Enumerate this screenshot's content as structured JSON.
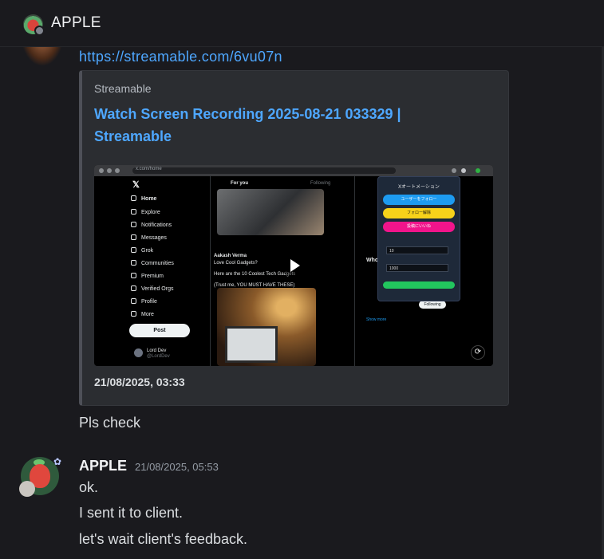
{
  "header": {
    "title": "APPLE"
  },
  "previous_message": {
    "link": "https://streamable.com/6vu07n",
    "embed": {
      "provider": "Streamable",
      "title": "Watch Screen Recording 2025-08-21 033329 | Streamable",
      "timestamp": "21/08/2025, 03:33",
      "video": {
        "browser_url": "x.com/home",
        "x_nav": [
          "Home",
          "Explore",
          "Notifications",
          "Messages",
          "Grok",
          "Communities",
          "Premium",
          "Verified Orgs",
          "Profile",
          "More"
        ],
        "post_button": "Post",
        "user_name": "Lord Dev",
        "user_handle": "@LordDev",
        "tabs": [
          "For you",
          "Following"
        ],
        "tweet_author": "Aakash Verma",
        "tweet_lines": [
          "Love Cool Gadgets?",
          "Here are the 10 Coolest Tech Gadgets",
          "(Trust me, YOU MUST HAVE THESE)"
        ],
        "popup_title": "Xオートメーション",
        "popup_buttons": [
          "ユーザーをフォロー",
          "フォロー解除",
          "投稿にいいね"
        ],
        "popup_inputs": [
          "10",
          "1000"
        ],
        "side_labels": [
          "Who",
          "Following",
          "Show more"
        ]
      }
    },
    "followup": "Pls check"
  },
  "message": {
    "author": "APPLE",
    "timestamp": "21/08/2025, 05:53",
    "lines": [
      "ok.",
      "I sent it to client.",
      "let's wait client's feedback."
    ]
  },
  "colors": {
    "link": "#4ea7ff",
    "background": "#1a1a1e",
    "embed": "#2b2d31"
  }
}
